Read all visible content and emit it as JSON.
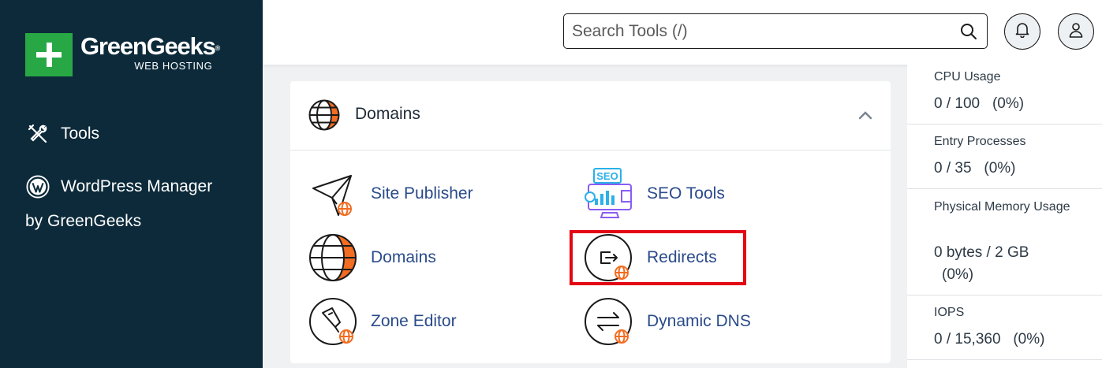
{
  "sidebar": {
    "brand_name": "GreenGeeks",
    "brand_mark": "®",
    "brand_sub": "WEB HOSTING",
    "items": [
      {
        "label": "Tools",
        "icon": "tools-icon"
      },
      {
        "label": "WordPress Manager",
        "icon": "wordpress-icon"
      }
    ],
    "wp_line2": "by GreenGeeks"
  },
  "header": {
    "search_placeholder": "Search Tools (/)",
    "icons": [
      "search-icon",
      "bell-icon",
      "user-icon"
    ]
  },
  "section": {
    "title": "Domains",
    "tools": [
      {
        "label": "Site Publisher",
        "icon": "site-publisher-icon"
      },
      {
        "label": "SEO Tools",
        "icon": "seo-tools-icon"
      },
      {
        "label": "Domains",
        "icon": "domains-icon"
      },
      {
        "label": "Redirects",
        "icon": "redirects-icon"
      },
      {
        "label": "Zone Editor",
        "icon": "zone-editor-icon"
      },
      {
        "label": "Dynamic DNS",
        "icon": "dynamic-dns-icon"
      }
    ]
  },
  "stats": [
    {
      "label": "CPU Usage",
      "value": "0 / 100   (0%)"
    },
    {
      "label": "Entry Processes",
      "value": "0 / 35   (0%)"
    },
    {
      "label": "Physical Memory Usage",
      "value": "0 bytes / 2 GB",
      "value2": "(0%)"
    },
    {
      "label": "IOPS",
      "value": "0 / 15,360   (0%)"
    }
  ],
  "colors": {
    "sidebar_bg": "#0c2a3a",
    "brand_green": "#27a844",
    "link_blue": "#2a4b8a",
    "accent_orange": "#f26c21",
    "highlight_red": "#e30613"
  }
}
